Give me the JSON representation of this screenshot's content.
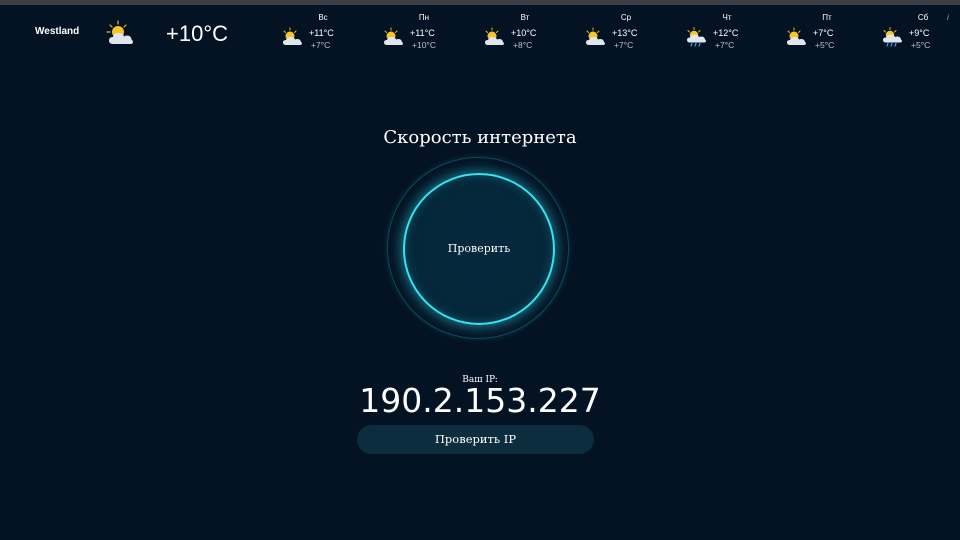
{
  "weather": {
    "city": "Westland",
    "current_icon": "sun-behind-cloud-icon",
    "current_temp": "+10°C",
    "days": [
      {
        "name": "Вс",
        "high": "+11°C",
        "low": "+7°C",
        "icon": "sun-behind-cloud-icon"
      },
      {
        "name": "Пн",
        "high": "+11°C",
        "low": "+10°C",
        "icon": "sun-behind-cloud-icon"
      },
      {
        "name": "Вт",
        "high": "+10°C",
        "low": "+8°C",
        "icon": "sun-behind-cloud-icon"
      },
      {
        "name": "Ср",
        "high": "+13°C",
        "low": "+7°C",
        "icon": "sun-behind-cloud-icon"
      },
      {
        "name": "Чт",
        "high": "+12°C",
        "low": "+7°C",
        "icon": "sun-cloud-rain-icon"
      },
      {
        "name": "Пт",
        "high": "+7°C",
        "low": "+5°C",
        "icon": "sun-behind-cloud-icon"
      },
      {
        "name": "Сб",
        "high": "+9°C",
        "low": "+5°C",
        "icon": "sun-cloud-rain-icon"
      }
    ],
    "info_mark": "i"
  },
  "speed_test": {
    "title": "Скорость интернета",
    "check_label": "Проверить"
  },
  "ip": {
    "label": "Ваш IP:",
    "value": "190.2.153.227",
    "button_label": "Проверить IP"
  },
  "colors": {
    "background": "#041324",
    "ring_accent": "#38e2ee",
    "button_bg": "#0b2d3e"
  }
}
